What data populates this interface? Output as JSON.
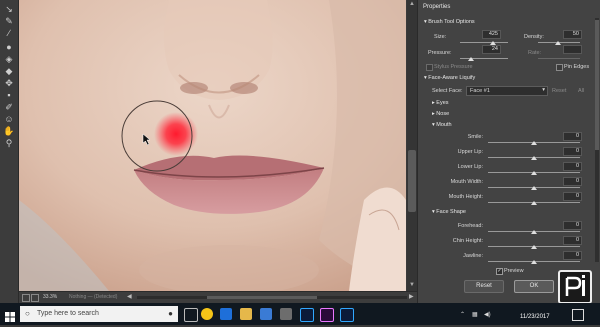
{
  "toolbar": {
    "tools": [
      "warp-icon",
      "reconstruct-icon",
      "smooth-icon",
      "twirl-icon",
      "pucker-icon",
      "bloat-icon",
      "push-left-icon",
      "freeze-mask-icon",
      "thaw-mask-icon",
      "face-tool-icon",
      "hand-icon",
      "zoom-icon"
    ]
  },
  "canvas": {
    "zoom": "33.3%",
    "status_text": "Nothing — (Detected)"
  },
  "properties": {
    "title": "Properties",
    "brush_tool_options": {
      "header": "Brush Tool Options",
      "size_label": "Size:",
      "size_value": "425",
      "density_label": "Density:",
      "density_value": "50",
      "pressure_label": "Pressure:",
      "pressure_value": "24",
      "rate_label": "Rate:",
      "rate_value": "",
      "stylus_pressure_label": "Stylus Pressure",
      "pin_edges_label": "Pin Edges"
    },
    "face_aware": {
      "header": "Face-Aware Liquify",
      "select_face_label": "Select Face:",
      "select_face_value": "Face #1",
      "reset_label": "Reset",
      "all_label": "All",
      "eyes_label": "Eyes",
      "nose_label": "Nose",
      "mouth_label": "Mouth",
      "face_shape_label": "Face Shape",
      "mouth_fields": [
        {
          "label": "Smile:",
          "value": "0"
        },
        {
          "label": "Upper Lip:",
          "value": "0"
        },
        {
          "label": "Lower Lip:",
          "value": "0"
        },
        {
          "label": "Mouth Width:",
          "value": "0"
        },
        {
          "label": "Mouth Height:",
          "value": "0"
        }
      ],
      "face_fields": [
        {
          "label": "Forehead:",
          "value": "0"
        },
        {
          "label": "Chin Height:",
          "value": "0"
        },
        {
          "label": "Jawline:",
          "value": "0"
        }
      ]
    },
    "preview_label": "Preview",
    "reset_button": "Reset",
    "ok_button": "OK"
  },
  "taskbar": {
    "search_placeholder": "Type here to search",
    "time": "",
    "date": "11/23/2017"
  },
  "colors": {
    "panel_bg": "#434343",
    "toolbar_bg": "#3c3c3c",
    "taskbar_bg": "#101820",
    "brush_red": "#ff1a2e"
  }
}
